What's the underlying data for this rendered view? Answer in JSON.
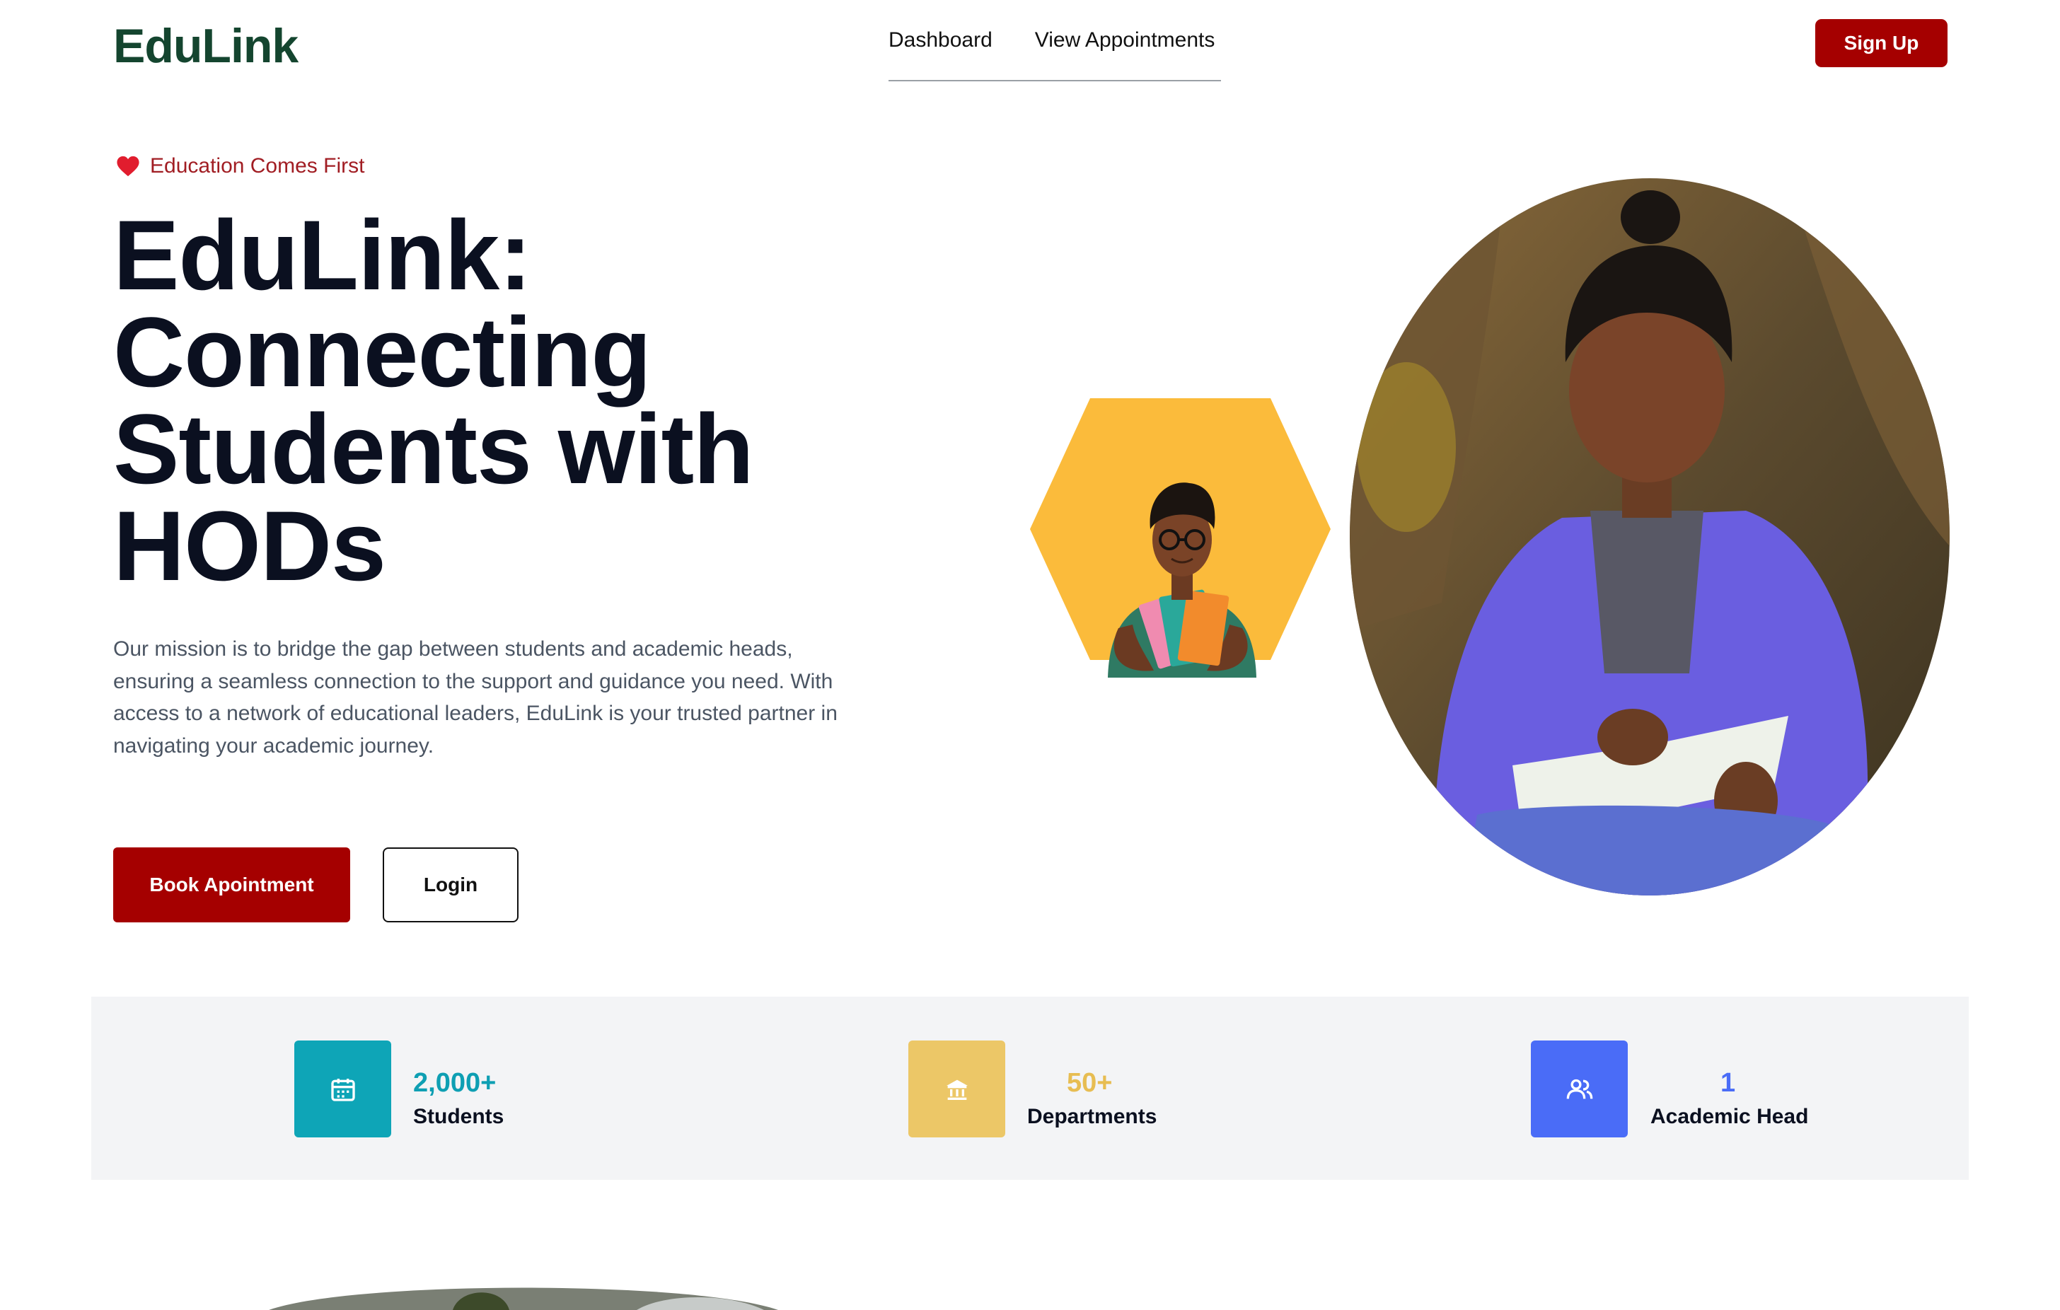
{
  "header": {
    "logo": "EduLink",
    "nav": [
      {
        "label": "Dashboard"
      },
      {
        "label": "View Appointments"
      }
    ],
    "signup_label": "Sign Up"
  },
  "hero": {
    "tagline": "Education Comes First",
    "title_lines": [
      "EduLink:",
      "Connecting",
      "Students with",
      "HODs"
    ],
    "description": "Our mission is to bridge the gap between students and academic heads, ensuring a seamless connection to the support and guidance you need. With access to a network of educational leaders, EduLink is your trusted partner in navigating your academic journey.",
    "book_label": "Book Apointment",
    "login_label": "Login"
  },
  "stats": [
    {
      "value": "2,000+",
      "label": "Students",
      "icon": "calendar-icon",
      "icon_bg": "#0ea5b7",
      "value_color": "#0e9fb3"
    },
    {
      "value": "50+",
      "label": "Departments",
      "icon": "building-icon",
      "icon_bg": "#ecc767",
      "value_color": "#e7bd52"
    },
    {
      "value": "1",
      "label": "Academic Head",
      "icon": "users-icon",
      "icon_bg": "#4a6cf7",
      "value_color": "#4a6cf7"
    }
  ],
  "colors": {
    "brand_dark_green": "#14452f",
    "primary_red": "#a50000",
    "tagline_red": "#a11d23",
    "stats_bg": "#f3f4f6"
  }
}
